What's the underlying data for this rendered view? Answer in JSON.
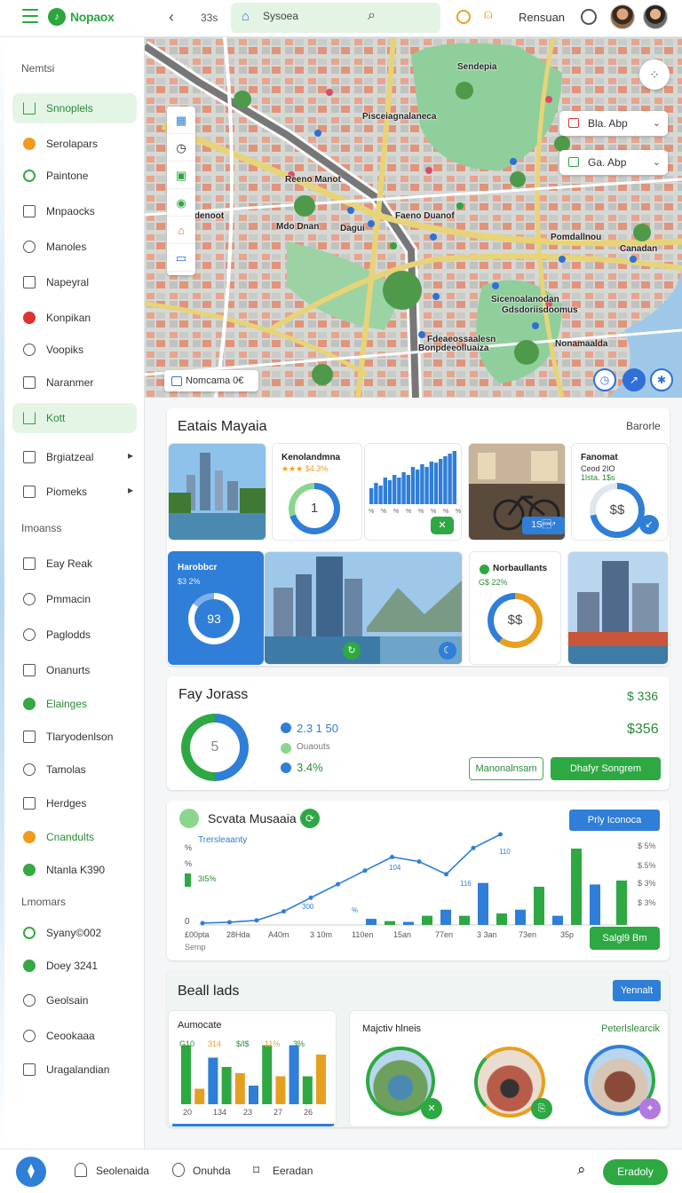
{
  "topbar": {
    "app_name": "Nopaox",
    "zoom": "33s",
    "search_value": "Sysoea",
    "user_name": "Rensuan"
  },
  "sidebar": {
    "sections": [
      "Nemtsi",
      "Imoanss",
      "Lmomars"
    ],
    "items": [
      {
        "label": "Snnoplels",
        "icon": "home-icon",
        "active": true
      },
      {
        "label": "Serolapars",
        "icon": "orange-dot-icon"
      },
      {
        "label": "Paintone",
        "icon": "timer-icon"
      },
      {
        "label": "Mnpaocks",
        "icon": "square-icon"
      },
      {
        "label": "Manoles",
        "icon": "compass-icon"
      },
      {
        "label": "Napeyral",
        "icon": "square-icon"
      },
      {
        "label": "Konpikan",
        "icon": "red-dot-icon"
      },
      {
        "label": "Voopiks",
        "icon": "circle-icon"
      },
      {
        "label": "Naranmer",
        "icon": "square-icon"
      },
      {
        "label": "Kott",
        "icon": "home-icon",
        "active": true
      },
      {
        "label": "Brgiatzeal",
        "icon": "edit-icon",
        "chevron": true
      },
      {
        "label": "Piomeks",
        "icon": "square-icon",
        "chevron": true
      },
      {
        "label": "Eay Reak",
        "icon": "edit-icon"
      },
      {
        "label": "Pmmacin",
        "icon": "circle-icon"
      },
      {
        "label": "Paglodds",
        "icon": "user-icon"
      },
      {
        "label": "Onanurts",
        "icon": "square-icon"
      },
      {
        "label": "Elainges",
        "icon": "green-check-icon",
        "green": true
      },
      {
        "label": "Tlaryodenlson",
        "icon": "edit-icon"
      },
      {
        "label": "Tamolas",
        "icon": "pin-icon"
      },
      {
        "label": "Herdges",
        "icon": "square-icon"
      },
      {
        "label": "Cnandults",
        "icon": "orange-dot-icon",
        "green": true
      },
      {
        "label": "Ntanla K390",
        "icon": "green-dot-icon"
      },
      {
        "label": "Syany©002",
        "icon": "green-ring-icon"
      },
      {
        "label": "Doey 3241",
        "icon": "green-dot-icon"
      },
      {
        "label": "Geolsain",
        "icon": "chat-icon"
      },
      {
        "label": "Ceookaaa",
        "icon": "user-icon"
      },
      {
        "label": "Uragalandian",
        "icon": "list-icon"
      }
    ]
  },
  "map": {
    "labels": [
      "Sendepia",
      "Pisceiagnalaneca",
      "Reeno Manot",
      "rdenoot",
      "Mdo Dnan",
      "Faeno Duanof",
      "Pomdallnou",
      "Dagui",
      "Canadan",
      "Sicenoalanodan",
      "Gdsdoriisdoomus",
      "Fdeaeossaalesn",
      "Bonpdeeolluaiza",
      "Nonamaalda"
    ],
    "chip": "Nomcama 0€",
    "filters": [
      {
        "label": "Bla. Abp"
      },
      {
        "label": "Ga. Abp"
      }
    ]
  },
  "events": {
    "title": "Eatais Mayaia",
    "link": "Barorle",
    "card1": {
      "title": "Kenolandmna",
      "sub": "★★★ $4.3%",
      "ring_value": "1",
      "progress": 0.7
    },
    "card2": {
      "ticks": [
        "%",
        "%",
        "%",
        "%",
        "%",
        "%",
        "%",
        "%"
      ],
      "values": [
        0.3,
        0.4,
        0.35,
        0.5,
        0.45,
        0.55,
        0.5,
        0.6,
        0.55,
        0.7,
        0.65,
        0.75,
        0.7,
        0.8,
        0.78,
        0.85,
        0.9,
        0.95,
        1.0
      ]
    },
    "card3": {
      "badge": "1S\u0001↗"
    },
    "card4": {
      "title": "Fanomat",
      "sub1": "Ceod 2IO",
      "sub2": "1lsta. 1$s",
      "ring_value": "$$",
      "progress": 0.72
    },
    "card5": {
      "title": "Harobbcr",
      "sub": "$3 2%",
      "ring_value": "93",
      "progress": 0.85
    },
    "card6": {
      "title": "Norbaullants",
      "sub": "G$ 22%",
      "ring_value": "$$",
      "progress": 0.6
    }
  },
  "payments": {
    "title": "Fay Jorass",
    "amount_top": "$ 336",
    "amount_mid": "$356",
    "ring_value": "5",
    "legend": [
      {
        "label": "2.3 1 50",
        "color": "#2f7ed8"
      },
      {
        "label": "Ouaouts",
        "color": "#8bd68f"
      },
      {
        "label": "3.4%",
        "color": "#2f7ed8"
      }
    ],
    "btn_outline": "Manonalnsam",
    "btn_primary": "Dhafyr Songrem"
  },
  "stats": {
    "title": "Scvata Musaaia",
    "btn_top": "Prly Iconoca",
    "legend_top": "Trersleaanty",
    "left_labels": [
      "%",
      "%",
      "3I5%"
    ],
    "right_labels": [
      "$ 5%",
      "$.5%",
      "$ 3%",
      "$ 3%",
      "$ 5%"
    ],
    "x_labels": [
      "£00pta",
      "28Hda",
      "A40m",
      "3 10m",
      "110en",
      "15an",
      "77en",
      "3 3an",
      "73en",
      "35p"
    ],
    "x_sub": "Semp",
    "zero": "0",
    "point_labels": [
      "300",
      "%",
      "104",
      "116",
      "110"
    ],
    "btn_bottom": "Salgl9 Bm",
    "chart_data": {
      "type": "bar",
      "series": [
        {
          "values": [
            0,
            0,
            0,
            0,
            0.08,
            0.05,
            0.04,
            0.12,
            0.2,
            0.12,
            0.55,
            0.15,
            0.2,
            0.5,
            0.12,
            1.0,
            0.53
          ]
        },
        {
          "values": [
            0.02,
            0.03,
            0.05,
            0.15,
            0.3,
            0.45,
            0.6,
            0.75,
            0.7,
            0.56,
            0.85,
            1.0
          ]
        }
      ]
    }
  },
  "bealls": {
    "title": "Beall lads",
    "btn": "Yennalt",
    "card1": {
      "title": "Aumocate",
      "top_labels": [
        "G10",
        "314",
        "$/l$",
        "11%",
        "3%"
      ],
      "x_labels": [
        "20",
        "134",
        "23",
        "27",
        "26"
      ],
      "chart_data": {
        "type": "bar",
        "values": [
          0.95,
          0.25,
          0.75,
          0.6,
          0.5,
          0.3,
          0.95,
          0.45,
          0.95,
          0.45,
          0.8
        ]
      }
    },
    "card2": {
      "title": "Majctiv hlneis",
      "link": "Peterlslearcik"
    }
  },
  "bottombar": {
    "items": [
      {
        "label": "Seolenaida"
      },
      {
        "label": "Onuhda"
      },
      {
        "label": "Eeradan"
      }
    ],
    "btn": "Eradoly"
  }
}
